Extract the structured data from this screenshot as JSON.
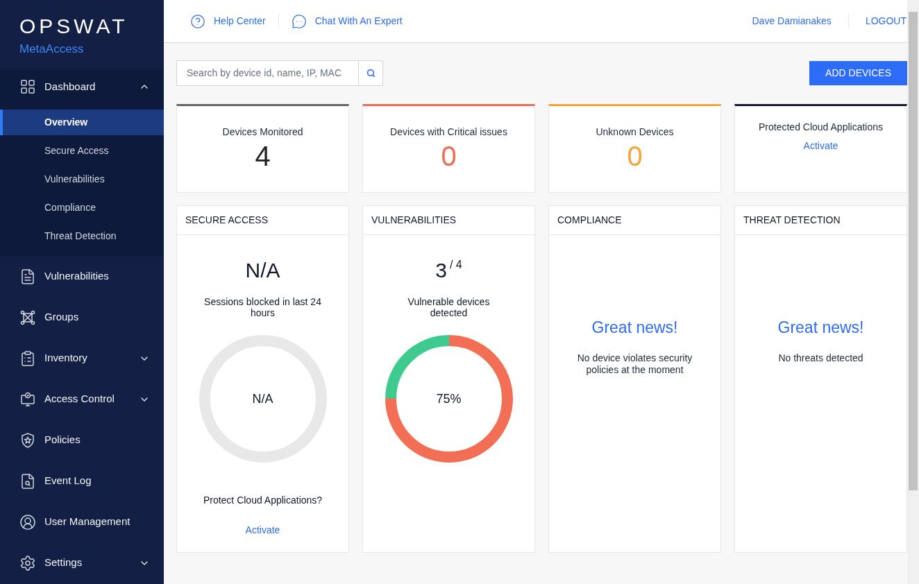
{
  "sidebar": {
    "logo": {
      "brand": "OPSWAT",
      "product": "MetaAccess"
    },
    "items": [
      {
        "label": "Dashboard",
        "expanded": true,
        "children": [
          {
            "label": "Overview",
            "selected": true
          },
          {
            "label": "Secure Access",
            "selected": false
          },
          {
            "label": "Vulnerabilities",
            "selected": false
          },
          {
            "label": "Compliance",
            "selected": false
          },
          {
            "label": "Threat Detection",
            "selected": false
          }
        ]
      },
      {
        "label": "Vulnerabilities"
      },
      {
        "label": "Groups"
      },
      {
        "label": "Inventory",
        "expanded": false
      },
      {
        "label": "Access Control",
        "expanded": false
      },
      {
        "label": "Policies"
      },
      {
        "label": "Event Log"
      },
      {
        "label": "User Management"
      },
      {
        "label": "Settings",
        "expanded": false
      }
    ]
  },
  "header": {
    "links": [
      "Help Center",
      "Chat With An Expert"
    ],
    "user": "Dave Damianakes",
    "logout": "LOGOUT"
  },
  "search": {
    "placeholder": "Search by device id, name, IP, MAC"
  },
  "add_button": "ADD DEVICES",
  "stat_cards": [
    {
      "kind": "number",
      "label": "Devices Monitored",
      "value": "4",
      "color": "#646464"
    },
    {
      "kind": "number",
      "label": "Devices with Critical issues",
      "value": "0",
      "color": "#f06c55"
    },
    {
      "kind": "number",
      "label": "Unknown Devices",
      "value": "0",
      "color": "#f2a73b"
    },
    {
      "kind": "link",
      "label": "Protected Cloud Applications",
      "link": "Activate",
      "color": "#141a3a"
    }
  ],
  "panels": [
    {
      "kind": "ring",
      "title": "SECURE ACCESS",
      "big": "N/A",
      "caption": "Sessions blocked in last 24 hours",
      "ring_text": "N/A",
      "footer": "Protect Cloud Applications?",
      "link": "Activate"
    },
    {
      "kind": "donut",
      "title": "VULNERABILITIES",
      "big": "3",
      "total": "/ 4",
      "caption": "Vulnerable devices detected",
      "level": 0.75,
      "ring_text": "75%"
    },
    {
      "kind": "message",
      "title": "COMPLIANCE",
      "headline": "Great news!",
      "text": "No device violates security policies at the moment"
    },
    {
      "kind": "message",
      "title": "THREAT DETECTION",
      "headline": "Great news!",
      "text": "No threats detected"
    }
  ]
}
